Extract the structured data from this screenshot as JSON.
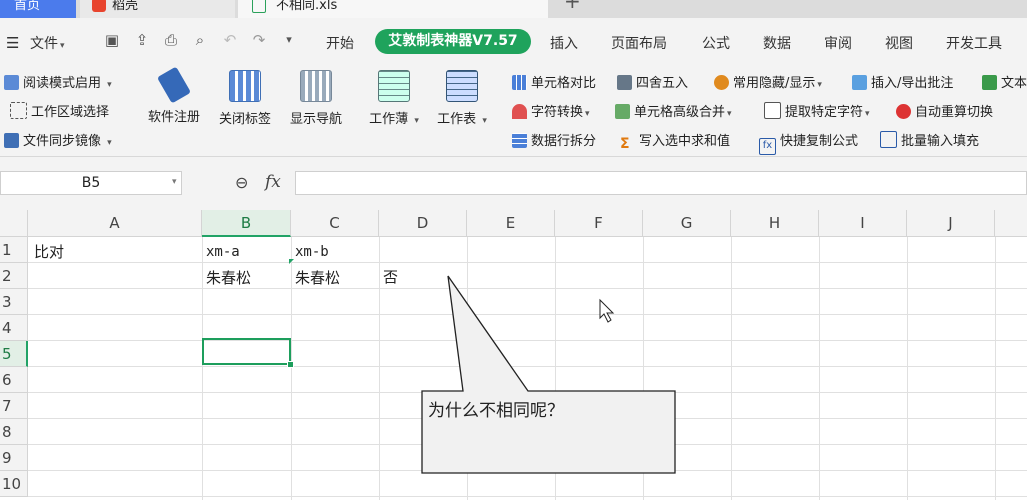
{
  "tabs": {
    "home": "首页",
    "store": "稻壳",
    "file": "不相同.xls",
    "new": "+"
  },
  "menu": {
    "hamburger": "☰",
    "file": "文件",
    "items": [
      "开始",
      "插入",
      "页面布局",
      "公式",
      "数据",
      "审阅",
      "视图",
      "开发工具"
    ],
    "special": "艾敦制表神器V7.57"
  },
  "ribbon": {
    "reading_mode": "阅读模式启用",
    "region_select": "工作区域选择",
    "file_mirror": "文件同步镜像",
    "software_register": "软件注册",
    "close_tabs": "关闭标签",
    "show_nav": "显示导航",
    "workbook": "工作薄",
    "worksheet": "工作表",
    "cell_compare": "单元格对比",
    "round": "四舍五入",
    "hide_show": "常用隐藏/显示",
    "insert_comment": "插入/导出批注",
    "text_cut": "文本",
    "char_convert": "字符转换",
    "cell_merge": "单元格高级合并",
    "extract_chars": "提取特定字符",
    "auto_recalc": "自动重算切换",
    "split_rows": "数据行拆分",
    "write_sum": "写入选中求和值",
    "copy_formula": "快捷复制公式",
    "batch_fill": "批量输入填充"
  },
  "formula_bar": {
    "name_box": "B5",
    "fx": "fx",
    "value": ""
  },
  "sheet": {
    "columns": [
      "A",
      "B",
      "C",
      "D",
      "E",
      "F",
      "G",
      "H",
      "I",
      "J"
    ],
    "rows": [
      "1",
      "2",
      "3",
      "4",
      "5",
      "6",
      "7",
      "8",
      "9",
      "10"
    ],
    "selected_column": "B",
    "selected_row": "5",
    "cells": {
      "A1": "比对",
      "B1": "xm-a",
      "C1": "xm-b",
      "B2": "朱春松",
      "C2": "朱春松",
      "D2": "否"
    }
  },
  "callout": {
    "text": "为什么不相同呢？"
  },
  "colors": {
    "accent": "#1fa35c",
    "home_tab": "#4b7bec"
  }
}
